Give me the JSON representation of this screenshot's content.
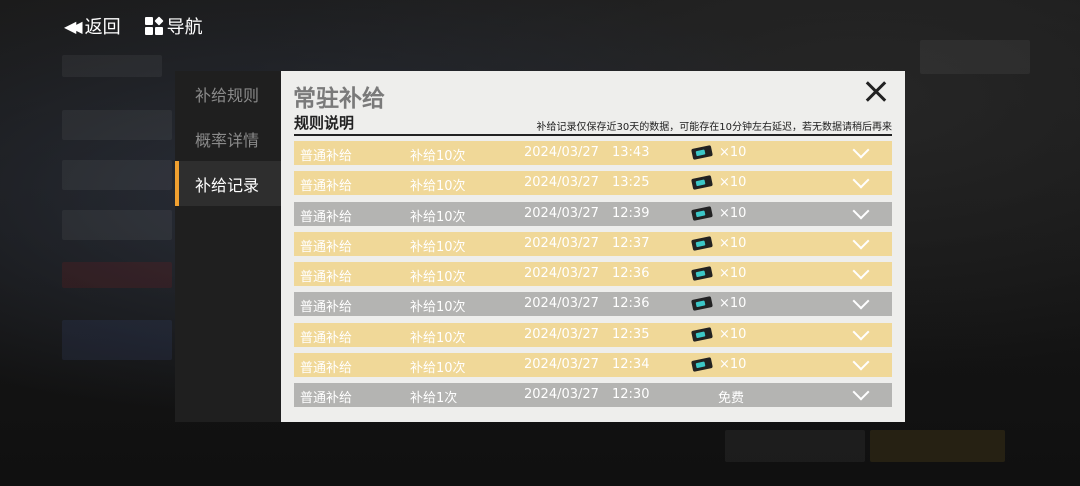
{
  "topbar": {
    "back_label": "返回",
    "nav_label": "导航"
  },
  "sidebar": {
    "items": [
      {
        "label": "补给规则",
        "active": false
      },
      {
        "label": "概率详情",
        "active": false
      },
      {
        "label": "补给记录",
        "active": true
      }
    ]
  },
  "panel": {
    "title": "常驻补给",
    "subtitle": "规则说明",
    "notice": "补给记录仅保存近30天的数据，可能存在10分钟左右延迟，若无数据请稍后再来"
  },
  "records": [
    {
      "type": "普通补给",
      "count": "补给10次",
      "date": "2024/03/27",
      "time": "13:43",
      "reward": "×10",
      "style": "gold"
    },
    {
      "type": "普通补给",
      "count": "补给10次",
      "date": "2024/03/27",
      "time": "13:25",
      "reward": "×10",
      "style": "gold"
    },
    {
      "type": "普通补给",
      "count": "补给10次",
      "date": "2024/03/27",
      "time": "12:39",
      "reward": "×10",
      "style": "gray"
    },
    {
      "type": "普通补给",
      "count": "补给10次",
      "date": "2024/03/27",
      "time": "12:37",
      "reward": "×10",
      "style": "gold"
    },
    {
      "type": "普通补给",
      "count": "补给10次",
      "date": "2024/03/27",
      "time": "12:36",
      "reward": "×10",
      "style": "gold"
    },
    {
      "type": "普通补给",
      "count": "补给10次",
      "date": "2024/03/27",
      "time": "12:36",
      "reward": "×10",
      "style": "gray"
    },
    {
      "type": "普通补给",
      "count": "补给10次",
      "date": "2024/03/27",
      "time": "12:35",
      "reward": "×10",
      "style": "gold"
    },
    {
      "type": "普通补给",
      "count": "补给10次",
      "date": "2024/03/27",
      "time": "12:34",
      "reward": "×10",
      "style": "gold"
    },
    {
      "type": "普通补给",
      "count": "补给1次",
      "date": "2024/03/27",
      "time": "12:30",
      "reward": "免费",
      "style": "gray",
      "free": true
    }
  ],
  "colors": {
    "gold_row": "#f0d898",
    "gray_row": "#b4b4b2",
    "accent": "#f0a030"
  },
  "icons": {
    "back": "double-chevron-left-icon",
    "nav": "grid-icon",
    "reward": "ticket-icon",
    "expand": "chevron-down-icon",
    "close": "close-icon"
  }
}
